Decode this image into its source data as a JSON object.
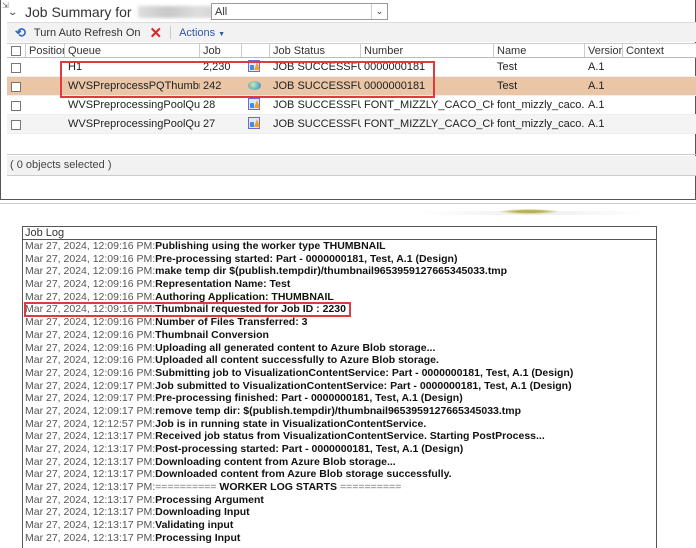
{
  "header": {
    "title": "Job Summary for",
    "filter": {
      "selected": "All"
    }
  },
  "toolbar": {
    "auto_refresh_label": "Turn Auto Refresh On",
    "actions_label": "Actions"
  },
  "grid": {
    "columns": [
      "Position",
      "Queue",
      "Job",
      "",
      "Job Status",
      "Number",
      "Name",
      "Version",
      "Context"
    ],
    "rows": [
      {
        "position": "",
        "queue": "H1",
        "job": "2,230",
        "icon": "job-icon",
        "status": "JOB SUCCESSFUL",
        "number": "0000000181",
        "name": "Test",
        "version": "A.1",
        "context": ""
      },
      {
        "position": "",
        "queue": "WVSPreprocessPQThumbnailH",
        "job": "242",
        "icon": "thumbnail-icon",
        "status": "JOB SUCCESSFUL",
        "number": "0000000181",
        "name": "Test",
        "version": "A.1",
        "context": ""
      },
      {
        "position": "",
        "queue": "WVSPreprocessingPoolQueueL",
        "job": "28",
        "icon": "job-icon",
        "status": "JOB SUCCESSFUL",
        "number": "FONT_MIZZLY_CACO_CHK.PRT",
        "name": "font_mizzly_caco.prt",
        "version": "A.1",
        "context": ""
      },
      {
        "position": "",
        "queue": "WVSPreprocessingPoolQueueL",
        "job": "27",
        "icon": "job-icon",
        "status": "JOB SUCCESSFUL",
        "number": "FONT_MIZZLY_CACO_CHK.PRT",
        "name": "font_mizzly_caco.prt",
        "version": "A.1",
        "context": ""
      }
    ],
    "status": "( 0 objects selected )"
  },
  "job_log": {
    "title": "Job Log",
    "lines": [
      {
        "ts": "Mar 27, 2024, 12:09:16 PM:",
        "msg": "Publishing using the worker type THUMBNAIL"
      },
      {
        "ts": "Mar 27, 2024, 12:09:16 PM:",
        "msg": "Pre-processing started: Part - 0000000181, Test, A.1 (Design)"
      },
      {
        "ts": "Mar 27, 2024, 12:09:16 PM:",
        "msg": "make temp dir $(publish.tempdir)/thumbnail9653959127665345033.tmp"
      },
      {
        "ts": "Mar 27, 2024, 12:09:16 PM:",
        "msg": "Representation Name: Test"
      },
      {
        "ts": "Mar 27, 2024, 12:09:16 PM:",
        "msg": "Authoring Application: THUMBNAIL"
      },
      {
        "ts": "Mar 27, 2024, 12:09:16 PM:",
        "msg": "Thumbnail requested for Job ID : 2230",
        "highlighted": true
      },
      {
        "ts": "Mar 27, 2024, 12:09:16 PM:",
        "msg": "Number of Files Transferred: 3"
      },
      {
        "ts": "Mar 27, 2024, 12:09:16 PM:",
        "msg": "Thumbnail Conversion"
      },
      {
        "ts": "Mar 27, 2024, 12:09:16 PM:",
        "msg": "Uploading all generated content to Azure Blob storage..."
      },
      {
        "ts": "Mar 27, 2024, 12:09:16 PM:",
        "msg": "Uploaded all content successfully to Azure Blob storage."
      },
      {
        "ts": "Mar 27, 2024, 12:09:16 PM:",
        "msg": "Submitting job to VisualizationContentService: Part - 0000000181, Test, A.1 (Design)"
      },
      {
        "ts": "Mar 27, 2024, 12:09:17 PM:",
        "msg": "Job submitted to VisualizationContentService: Part - 0000000181, Test, A.1 (Design)"
      },
      {
        "ts": "Mar 27, 2024, 12:09:17 PM:",
        "msg": "Pre-processing finished: Part - 0000000181, Test, A.1 (Design)"
      },
      {
        "ts": "Mar 27, 2024, 12:09:17 PM:",
        "msg": "remove temp dir: $(publish.tempdir)/thumbnail9653959127665345033.tmp"
      },
      {
        "ts": "Mar 27, 2024, 12:12:57 PM:",
        "msg": "Job is in running state in VisualizationContentService."
      },
      {
        "ts": "Mar 27, 2024, 12:13:17 PM:",
        "msg": "Received job status from VisualizationContentService. Starting PostProcess..."
      },
      {
        "ts": "Mar 27, 2024, 12:13:17 PM:",
        "msg": "Post-processing started: Part - 0000000181, Test, A.1 (Design)"
      },
      {
        "ts": "Mar 27, 2024, 12:13:17 PM:",
        "msg": "Downloading content from Azure Blob storage..."
      },
      {
        "ts": "Mar 27, 2024, 12:13:17 PM:",
        "msg": "Downloaded content from Azure Blob storage successfully."
      },
      {
        "ts": "Mar 27, 2024, 12:13:17 PM:",
        "msg": "========== WORKER LOG STARTS ==========",
        "separator": true
      },
      {
        "ts": "Mar 27, 2024, 12:13:17 PM:",
        "msg": "Processing Argument"
      },
      {
        "ts": "Mar 27, 2024, 12:13:17 PM:",
        "msg": "Downloading Input"
      },
      {
        "ts": "Mar 27, 2024, 12:13:17 PM:",
        "msg": "Validating input"
      },
      {
        "ts": "Mar 27, 2024, 12:13:17 PM:",
        "msg": "Processing Input"
      }
    ]
  },
  "colors": {
    "selected_row": "#eac5a6",
    "highlight_border": "#e0393e",
    "accent_blue": "#2b6cc4",
    "cancel_red": "#d9262c"
  }
}
